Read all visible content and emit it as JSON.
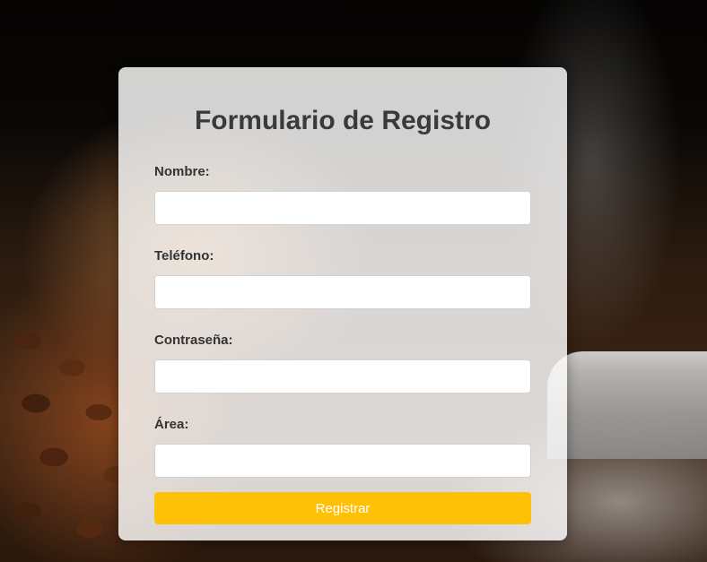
{
  "form": {
    "title": "Formulario de Registro",
    "fields": [
      {
        "label": "Nombre:",
        "value": "",
        "placeholder": ""
      },
      {
        "label": "Teléfono:",
        "value": "",
        "placeholder": ""
      },
      {
        "label": "Contraseña:",
        "value": "",
        "placeholder": ""
      },
      {
        "label": "Área:",
        "value": "",
        "placeholder": ""
      }
    ],
    "submit_label": "Registrar"
  },
  "colors": {
    "accent": "#ffc107",
    "card_background": "rgba(255,255,255,0.82)",
    "title_text": "#3a3a3a"
  }
}
